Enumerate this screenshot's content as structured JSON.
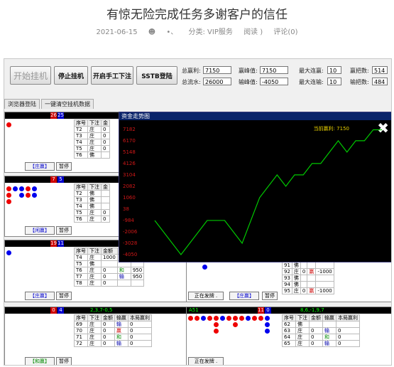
{
  "article": {
    "title": "有惊无险完成任务多谢客户的信任",
    "date": "2021-06-15",
    "author": "•、",
    "category": "分类: VIP服务",
    "views": "阅读 )",
    "comments": "评论(0)"
  },
  "toolbar": {
    "start_label": "开始挂机",
    "stop_label": "停止挂机",
    "manual_label": "开启手工下注",
    "login_label": "SSTB登陆"
  },
  "stats": {
    "total_profit_label": "总赢利:",
    "total_profit_value": "7150",
    "total_flow_label": "总流水:",
    "total_flow_value": "26000",
    "profit_peak_label": "赢峰值:",
    "profit_peak_value": "7150",
    "loss_peak_label": "输峰值:",
    "loss_peak_value": "-4050",
    "max_win_streak_label": "最大连赢:",
    "max_win_streak_value": "10",
    "max_loss_streak_label": "最大连输:",
    "max_loss_streak_value": "10",
    "win_count_label": "赢把数:",
    "win_count_value": "514",
    "loss_count_label": "输把数:",
    "loss_count_value": "484"
  },
  "tabs": [
    "浏览器登陆",
    "一键清空挂机数据"
  ],
  "chart_panel": {
    "title": "资金走势图",
    "current_label": "当前赢利: 7150",
    "close_icon": "close-icon"
  },
  "chart_data": {
    "type": "line",
    "title": "资金走势图",
    "y_tick_labels": [
      "7182",
      "6170",
      "5148",
      "4126",
      "3104",
      "2082",
      "1060",
      "38",
      "-984",
      "-2006",
      "-3028",
      "-4050"
    ],
    "ylim": [
      -4050,
      7182
    ],
    "x": [
      0,
      1,
      2,
      3,
      4,
      5,
      6,
      7,
      8,
      9,
      10,
      11,
      12,
      13,
      14,
      15,
      16,
      17,
      18,
      19,
      20,
      21,
      22,
      23,
      24,
      25,
      26
    ],
    "values": [
      -984,
      -2006,
      -3028,
      -4050,
      -3028,
      -2006,
      -984,
      -984,
      -984,
      -2006,
      -3028,
      -984,
      1060,
      2082,
      3104,
      2082,
      3104,
      3104,
      4126,
      4126,
      5148,
      6170,
      5148,
      6170,
      6170,
      7150,
      7150
    ],
    "grid": false,
    "line_color": "#00c800"
  },
  "panels": [
    {
      "head": "",
      "badge1": "26",
      "badge2": "25",
      "btn_label": "【庄赢】",
      "pause_label": "暂停",
      "headers": [
        "序号",
        "下注",
        "金"
      ],
      "rows": [
        [
          "T2",
          "庄",
          "0"
        ],
        [
          "T3",
          "庄",
          "0"
        ],
        [
          "T4",
          "庄",
          "0"
        ],
        [
          "T5",
          "庄",
          "0"
        ],
        [
          "T6",
          "佛",
          ""
        ]
      ]
    },
    {
      "head": "",
      "badge1": "7",
      "badge2": "5",
      "btn_label": "【闲赢】",
      "pause_label": "暂停",
      "headers": [
        "序号",
        "下注",
        "金"
      ],
      "rows": [
        [
          "T2",
          "佛",
          ""
        ],
        [
          "T3",
          "佛",
          ""
        ],
        [
          "T4",
          "佛",
          ""
        ],
        [
          "T5",
          "庄",
          "0"
        ],
        [
          "T6",
          "庄",
          "0"
        ]
      ]
    },
    {
      "head": "",
      "badge1": "19",
      "badge2": "11",
      "btn_label": "【庄赢】",
      "pause_label": "暂停",
      "headers": [
        "序号",
        "下注",
        "金额",
        "输赢"
      ],
      "rows": [
        [
          "T4",
          "庄",
          "1000",
          "赢",
          "950"
        ],
        [
          "T5",
          "佛",
          "",
          "",
          ""
        ],
        [
          "T6",
          "庄",
          "0",
          "和",
          "950"
        ],
        [
          "T7",
          "庄",
          "0",
          "输",
          "950"
        ],
        [
          "T8",
          "庄",
          "0",
          "",
          ""
        ]
      ]
    }
  ],
  "right_mid": {
    "status": "正在发牌 .",
    "btn_label": "【庄赢】",
    "pause_label": "暂停",
    "rows": [
      [
        "91",
        "佛",
        "",
        "",
        ""
      ],
      [
        "92",
        "庄",
        "0",
        "赢",
        "-1000"
      ],
      [
        "93",
        "佛",
        "",
        "",
        ""
      ],
      [
        "94",
        "佛",
        "",
        "",
        ""
      ],
      [
        "95",
        "庄",
        "0",
        "赢",
        "-1000"
      ]
    ]
  },
  "bottom_left": {
    "badge1": "0",
    "badge2": "4",
    "pattern": "2,3,7-0,5",
    "headers": [
      "序号",
      "下注",
      "金额",
      "输赢",
      "本局赢利"
    ],
    "rows": [
      [
        "69",
        "庄",
        "0",
        "输",
        "0"
      ],
      [
        "70",
        "庄",
        "0",
        "赢",
        "0"
      ],
      [
        "71",
        "庄",
        "0",
        "和",
        "0"
      ],
      [
        "72",
        "庄",
        "0",
        "输",
        "0"
      ]
    ],
    "btn_label": "【和赢】",
    "pause_label": "暂停"
  },
  "bottom_right": {
    "name": "A51",
    "badge1": "11",
    "badge2": "0",
    "pattern": "8,6,-1,9,7",
    "headers": [
      "序号",
      "下注",
      "金额",
      "输赢",
      "本局赢利"
    ],
    "rows": [
      [
        "62",
        "佛",
        "",
        "",
        ""
      ],
      [
        "63",
        "庄",
        "0",
        "输",
        "0"
      ],
      [
        "64",
        "庄",
        "0",
        "和",
        "0"
      ],
      [
        "65",
        "庄",
        "0",
        "输",
        "0"
      ]
    ],
    "status": "正在发牌 ."
  }
}
